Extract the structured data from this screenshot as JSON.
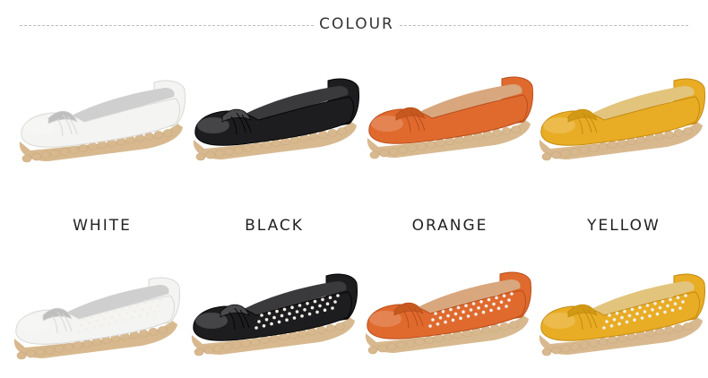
{
  "header": {
    "title": "COLOUR"
  },
  "colors": [
    {
      "name": "WHITE",
      "upper": "#f4f4f2",
      "shade": "#d9d9d6",
      "lining": "#cfcfcf",
      "accent": "#bfbfbf"
    },
    {
      "name": "BLACK",
      "upper": "#1d1d1f",
      "shade": "#050506",
      "lining": "#3a3a3c",
      "accent": "#4a4a4c"
    },
    {
      "name": "ORANGE",
      "upper": "#e06a2e",
      "shade": "#b94e1c",
      "lining": "#d8a77e",
      "accent": "#c7591f"
    },
    {
      "name": "YELLOW",
      "upper": "#e8ad25",
      "shade": "#c58a10",
      "lining": "#e2c47d",
      "accent": "#d29914"
    }
  ],
  "sole_color": "#d8b98f",
  "rows": [
    {
      "style": "closed"
    },
    {
      "style": "perforated"
    }
  ]
}
